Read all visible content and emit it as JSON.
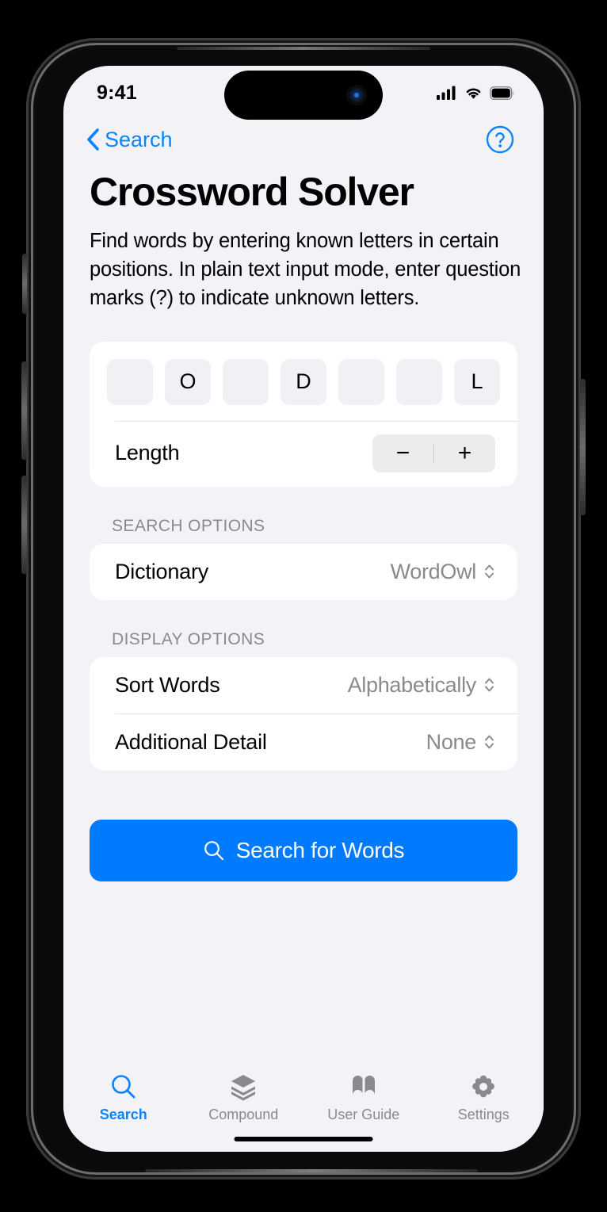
{
  "status_bar": {
    "time": "9:41",
    "cellular_icon": "cellular-signal-icon",
    "wifi_icon": "wifi-icon",
    "battery_icon": "battery-icon"
  },
  "nav": {
    "back_label": "Search",
    "back_icon": "chevron-left-icon",
    "help_icon": "question-mark-circle-icon"
  },
  "page": {
    "title": "Crossword Solver",
    "description": "Find words by entering known letters in certain positions. In plain text input mode, enter question marks (?) to indicate unknown letters."
  },
  "pattern": {
    "letters": [
      "",
      "O",
      "",
      "D",
      "",
      "",
      "L"
    ],
    "length_label": "Length",
    "minus_label": "−",
    "plus_label": "+"
  },
  "search_options": {
    "header": "SEARCH OPTIONS",
    "rows": [
      {
        "label": "Dictionary",
        "value": "WordOwl",
        "chevron": "⌃"
      }
    ]
  },
  "display_options": {
    "header": "DISPLAY OPTIONS",
    "rows": [
      {
        "label": "Sort Words",
        "value": "Alphabetically"
      },
      {
        "label": "Additional Detail",
        "value": "None"
      }
    ]
  },
  "search_button": {
    "label": "Search for Words",
    "icon": "magnifier-icon",
    "color": "#007aff"
  },
  "tab_bar": {
    "items": [
      {
        "label": "Search",
        "icon": "magnifier-icon",
        "active": true
      },
      {
        "label": "Compound",
        "icon": "layers-icon",
        "active": false
      },
      {
        "label": "User Guide",
        "icon": "book-icon",
        "active": false
      },
      {
        "label": "Settings",
        "icon": "gear-icon",
        "active": false
      }
    ]
  },
  "colors": {
    "accent": "#0a84ff",
    "button": "#007aff",
    "screen_bg": "#f2f2f7",
    "card_bg": "#ffffff",
    "secondary_text": "#8a8a8e"
  }
}
